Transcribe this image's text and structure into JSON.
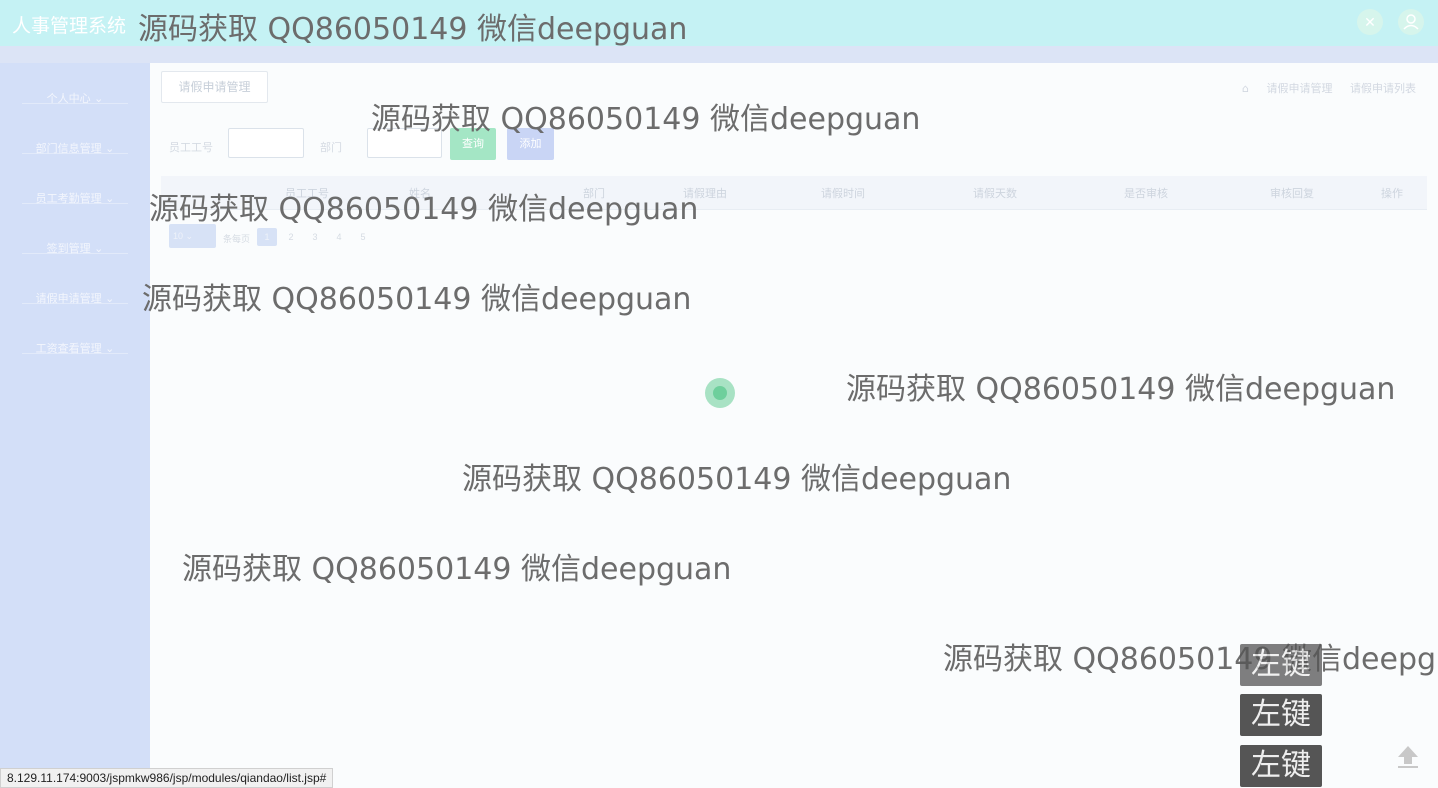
{
  "app": {
    "title": "人事管理系统",
    "fullscreen_icon": "expand-icon",
    "user_icon": "user-icon"
  },
  "sidebar": {
    "items": [
      {
        "label": "个人中心"
      },
      {
        "label": "部门信息管理"
      },
      {
        "label": "员工考勤管理"
      },
      {
        "label": "签到管理"
      },
      {
        "label": "请假申请管理"
      },
      {
        "label": "工资查看管理"
      }
    ]
  },
  "page": {
    "title_button": "请假申请管理",
    "breadcrumb": [
      "请假申请管理",
      "请假申请列表"
    ]
  },
  "search": {
    "employee_id_label": "员工工号",
    "employee_id_value": "",
    "dept_label": "部门",
    "dept_value": "",
    "query_button": "查询",
    "add_button": "添加"
  },
  "table": {
    "columns": [
      "员工工号",
      "姓名",
      "部门",
      "请假理由",
      "请假时间",
      "请假天数",
      "是否审核",
      "审核回复",
      "操作"
    ],
    "rows": []
  },
  "pager": {
    "page_size": "10",
    "page_size_suffix": "条每页",
    "pages": [
      "1",
      "2",
      "3",
      "4",
      "5"
    ],
    "current": "1"
  },
  "watermark": {
    "text": "源码获取 QQ86050149 微信deepguan"
  },
  "key_overlay": {
    "labels": [
      "左键",
      "左键",
      "左键"
    ]
  },
  "status_bar": {
    "url": "8.129.11.174:9003/jspmkw986/jsp/modules/qiandao/list.jsp#"
  },
  "colors": {
    "topbar": "#c5f2f4",
    "sidebar": "#d3dff8",
    "query_button": "#a4e6c5",
    "add_button": "#c9d5f5"
  }
}
